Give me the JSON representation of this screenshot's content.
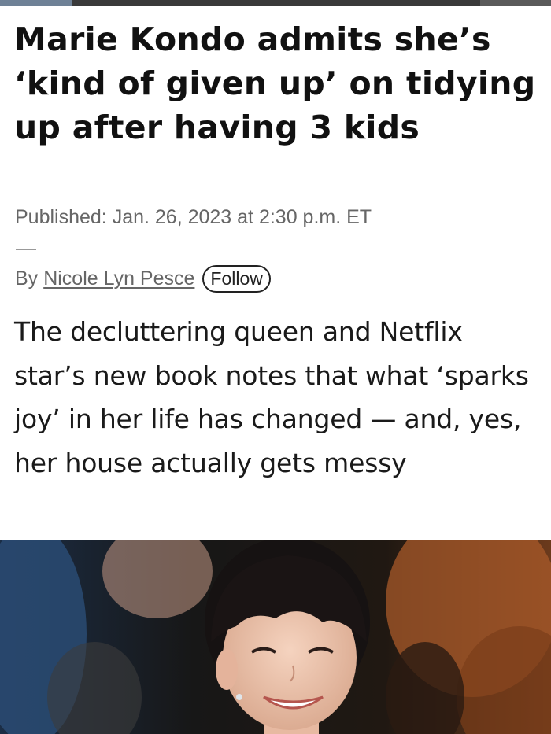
{
  "article": {
    "headline": "Marie Kondo admits she’s ‘kind of given up’ on tidying up after having 3 kids",
    "published": "Published: Jan. 26, 2023 at 2:30 p.m. ET",
    "byline_prefix": "By",
    "author": "Nicole Lyn Pesce",
    "follow_label": "Follow",
    "dek": "The decluttering queen and Netflix star’s new book notes that what ‘sparks joy’ in her life has changed — and, yes, her house actually gets messy"
  },
  "colors": {
    "text": "#111111",
    "meta": "#666666",
    "top_bar": "#3a3a3a"
  },
  "photo": {
    "subject": "smiling woman with dark hair and bangs"
  }
}
